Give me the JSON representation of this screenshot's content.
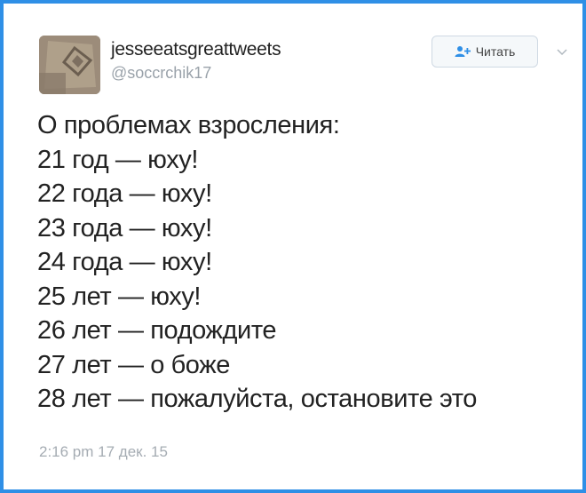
{
  "tweet": {
    "display_name": "jesseeatsgreattweets",
    "handle": "@soccrchik17",
    "follow_label": "Читать",
    "lines": [
      "О проблемах взросления:",
      "21 год — юху!",
      "22 года — юху!",
      "23 года — юху!",
      "24 года — юху!",
      "25 лет — юху!",
      "26 лет — подождите",
      "27 лет — о боже",
      "28 лет — пожалуйста, остановите это"
    ],
    "timestamp": "2:16 pm 17 дек. 15"
  },
  "colors": {
    "frame": "#2f8fe6",
    "accent": "#2f8fe6",
    "text": "#222222",
    "muted": "#9aa2aa"
  },
  "icons": {
    "follow": "add-user-icon",
    "menu": "chevron-down-icon"
  }
}
